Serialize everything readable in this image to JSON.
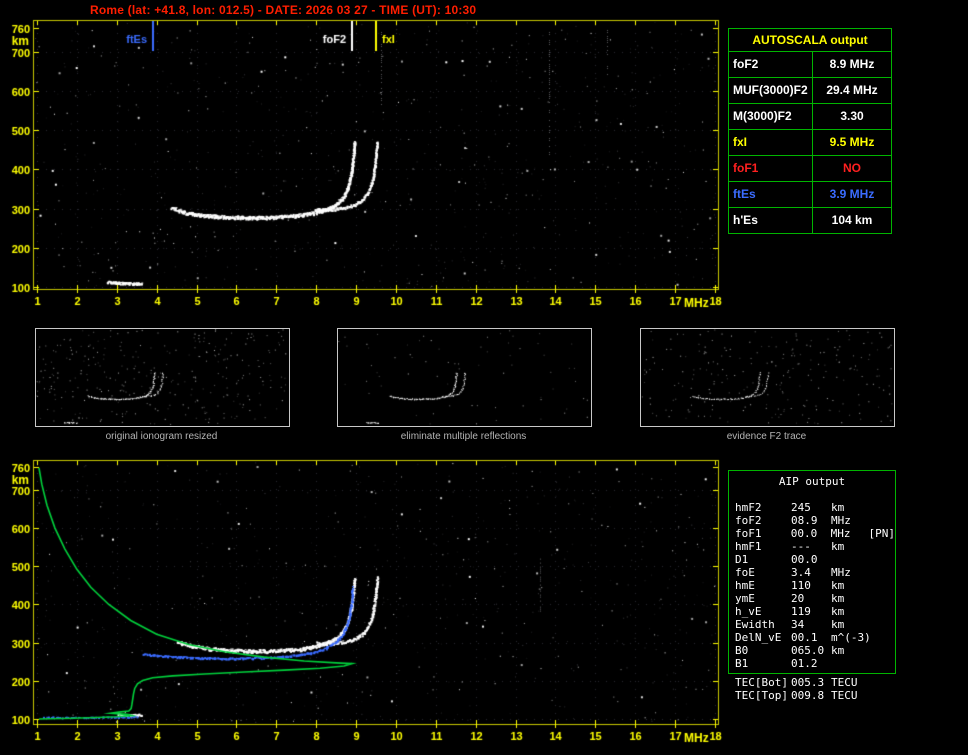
{
  "title": "Rome (lat: +41.8, lon: 012.5) - DATE: 2026 03 27 - TIME (UT): 10:30",
  "autoscala": {
    "header": "AUTOSCALA output",
    "border_color": "#00b400",
    "rows": [
      {
        "label": "foF2",
        "value": "8.9 MHz",
        "color": "#ffffff"
      },
      {
        "label": "MUF(3000)F2",
        "value": "29.4 MHz",
        "color": "#ffffff"
      },
      {
        "label": "M(3000)F2",
        "value": "3.30",
        "color": "#ffffff"
      },
      {
        "label": "fxI",
        "value": "9.5 MHz",
        "color": "#ffff00"
      },
      {
        "label": "foF1",
        "value": "NO",
        "color": "#ff2020"
      },
      {
        "label": "ftEs",
        "value": "3.9 MHz",
        "color": "#3b6cff"
      },
      {
        "label": "h'Es",
        "value": "104  km",
        "color": "#ffffff"
      }
    ]
  },
  "thumbnails": {
    "captions": [
      "original ionogram resized",
      "eliminate multiple reflections",
      "evidence F2 trace"
    ],
    "configs": [
      {
        "noise": 310,
        "density_mul": 0.5
      },
      {
        "noise": 70,
        "density_mul": 0.5
      },
      {
        "noise": 240,
        "density_mul": 0.35,
        "min_height": 280
      }
    ]
  },
  "aip": {
    "header": "AIP output",
    "rows": [
      {
        "label": "hmF2",
        "value": "245",
        "unit": "km",
        "extra": ""
      },
      {
        "label": "foF2",
        "value": "08.9",
        "unit": "MHz",
        "extra": ""
      },
      {
        "label": "foF1",
        "value": "00.0",
        "unit": "MHz",
        "extra": "[PN]"
      },
      {
        "label": "hmF1",
        "value": "---",
        "unit": "km",
        "extra": ""
      },
      {
        "label": "D1",
        "value": "00.0",
        "unit": "",
        "extra": ""
      },
      {
        "label": "foE",
        "value": "3.4",
        "unit": "MHz",
        "extra": ""
      },
      {
        "label": "hmE",
        "value": "110",
        "unit": "km",
        "extra": ""
      },
      {
        "label": "ymE",
        "value": "20",
        "unit": "km",
        "extra": ""
      },
      {
        "label": "h_vE",
        "value": "119",
        "unit": "km",
        "extra": ""
      },
      {
        "label": "Ewidth",
        "value": "34",
        "unit": "km",
        "extra": ""
      },
      {
        "label": "DelN_vE",
        "value": "00.1",
        "unit": "m^(-3)",
        "extra": ""
      },
      {
        "label": "B0",
        "value": "065.0",
        "unit": "km",
        "extra": ""
      },
      {
        "label": "B1",
        "value": "01.2",
        "unit": "",
        "extra": ""
      }
    ],
    "tec_rows": [
      {
        "label": "TEC[Bot]",
        "value": "005.3",
        "unit": "TECU",
        "extra": ""
      },
      {
        "label": "TEC[Top]",
        "value": "009.8",
        "unit": "TECU",
        "extra": ""
      }
    ]
  },
  "chart_data": [
    {
      "id": "scaled-ionogram",
      "type": "scatter",
      "title": "",
      "xlabel": "MHz",
      "ylabel": "km",
      "xlim": [
        1,
        18
      ],
      "ylim": [
        100,
        760
      ],
      "x_ticks": [
        1,
        2,
        3,
        4,
        5,
        6,
        7,
        8,
        9,
        10,
        11,
        12,
        13,
        14,
        15,
        16,
        17,
        18
      ],
      "y_ticks": [
        760,
        700,
        600,
        500,
        400,
        300,
        200,
        100
      ],
      "frame_color": "#c8c800",
      "axis_color": "#ffff00",
      "grid": "dotted",
      "markers": [
        {
          "label": "ftEs",
          "x": 3.9,
          "color": "#3b6cff",
          "side": "left"
        },
        {
          "label": "foF2",
          "x": 8.9,
          "color": "#ffffff",
          "side": "left"
        },
        {
          "label": "fxI",
          "x": 9.5,
          "color": "#ffff00",
          "side": "right"
        }
      ],
      "noise": {
        "bright": 240,
        "dim": 430
      },
      "streaks": [
        {
          "f": 13.85,
          "top": 760,
          "bottom": 420
        },
        {
          "f": 9.62,
          "top": 760,
          "bottom": 560
        },
        {
          "f": 15.3,
          "top": 760,
          "bottom": 640
        }
      ],
      "series": [
        {
          "name": "Es trace",
          "color": "#ffffff",
          "style": "dots",
          "size": 2,
          "density": 2.2,
          "jitter": 1.0,
          "points": [
            [
              2.75,
              114
            ],
            [
              3.1,
              111
            ],
            [
              3.4,
              110
            ],
            [
              3.62,
              111
            ]
          ]
        },
        {
          "name": "F2 ordinary trace",
          "color": "#ffffff",
          "style": "dots",
          "size": 2,
          "density": 2.4,
          "jitter": 1.6,
          "points": [
            [
              4.35,
              303
            ],
            [
              4.7,
              291
            ],
            [
              5.1,
              284
            ],
            [
              5.6,
              280
            ],
            [
              6.1,
              278
            ],
            [
              6.6,
              278
            ],
            [
              7.1,
              280
            ],
            [
              7.5,
              283
            ],
            [
              7.9,
              289
            ],
            [
              8.2,
              297
            ],
            [
              8.45,
              309
            ],
            [
              8.65,
              327
            ],
            [
              8.78,
              352
            ],
            [
              8.87,
              390
            ],
            [
              8.92,
              435
            ],
            [
              8.95,
              470
            ]
          ]
        },
        {
          "name": "F2 extraordinary trace",
          "color": "#ffffff",
          "style": "dots",
          "size": 2,
          "density": 1.7,
          "jitter": 1.2,
          "points": [
            [
              7.95,
              299
            ],
            [
              8.3,
              298
            ],
            [
              8.65,
              302
            ],
            [
              8.95,
              310
            ],
            [
              9.15,
              322
            ],
            [
              9.3,
              343
            ],
            [
              9.4,
              372
            ],
            [
              9.46,
              408
            ],
            [
              9.5,
              448
            ],
            [
              9.52,
              472
            ]
          ]
        }
      ]
    },
    {
      "id": "restored-ionogram-with-profile",
      "type": "scatter",
      "title": "",
      "xlabel": "MHz",
      "ylabel": "km",
      "xlim": [
        1,
        18
      ],
      "ylim": [
        100,
        760
      ],
      "x_ticks": [
        1,
        2,
        3,
        4,
        5,
        6,
        7,
        8,
        9,
        10,
        11,
        12,
        13,
        14,
        15,
        16,
        17,
        18
      ],
      "y_ticks": [
        760,
        700,
        600,
        500,
        400,
        300,
        200,
        100
      ],
      "frame_color": "#c8c800",
      "axis_color": "#ffff00",
      "grid": "dotted",
      "markers": [],
      "noise": {
        "bright": 190,
        "dim": 360
      },
      "streaks": [
        {
          "f": 13.6,
          "top": 520,
          "bottom": 380
        }
      ],
      "series": [
        {
          "name": "F2 ordinary trace",
          "color": "#ffffff",
          "style": "dots",
          "size": 2,
          "density": 2.2,
          "jitter": 1.6,
          "points": [
            [
              4.5,
              303
            ],
            [
              4.9,
              292
            ],
            [
              5.3,
              285
            ],
            [
              5.8,
              281
            ],
            [
              6.3,
              279
            ],
            [
              6.8,
              279
            ],
            [
              7.2,
              281
            ],
            [
              7.6,
              284
            ],
            [
              7.9,
              290
            ],
            [
              8.2,
              298
            ],
            [
              8.45,
              310
            ],
            [
              8.65,
              328
            ],
            [
              8.78,
              353
            ],
            [
              8.87,
              392
            ],
            [
              8.92,
              437
            ],
            [
              8.95,
              470
            ]
          ]
        },
        {
          "name": "F2 extraordinary trace",
          "color": "#ffffff",
          "style": "dots",
          "size": 2,
          "density": 1.6,
          "jitter": 1.2,
          "points": [
            [
              8.0,
              300
            ],
            [
              8.35,
              299
            ],
            [
              8.7,
              303
            ],
            [
              8.95,
              311
            ],
            [
              9.15,
              323
            ],
            [
              9.3,
              344
            ],
            [
              9.4,
              373
            ],
            [
              9.46,
              410
            ],
            [
              9.5,
              450
            ],
            [
              9.52,
              473
            ]
          ]
        },
        {
          "name": "Es trace",
          "color": "#ffffff",
          "style": "dots",
          "size": 2,
          "density": 1.8,
          "jitter": 0.8,
          "points": [
            [
              3.0,
              114
            ],
            [
              3.3,
              111
            ],
            [
              3.6,
              112
            ]
          ]
        },
        {
          "name": "autoscala restored trace",
          "color": "#3b6cff",
          "style": "dots",
          "size": 2,
          "density": 1.2,
          "jitter": 0.7,
          "points": [
            [
              3.65,
              271
            ],
            [
              4.1,
              266
            ],
            [
              4.6,
              263
            ],
            [
              5.1,
              261
            ],
            [
              5.6,
              260
            ],
            [
              6.1,
              260
            ],
            [
              6.6,
              261
            ],
            [
              7.1,
              264
            ],
            [
              7.5,
              268
            ],
            [
              7.9,
              275
            ],
            [
              8.2,
              285
            ],
            [
              8.45,
              300
            ],
            [
              8.65,
              322
            ],
            [
              8.78,
              352
            ],
            [
              8.87,
              400
            ],
            [
              8.9,
              448
            ]
          ]
        },
        {
          "name": "E region restored trace",
          "color": "#3b6cff",
          "style": "dots",
          "size": 2,
          "density": 0.5,
          "jitter": 0.4,
          "points": [
            [
              1.15,
              106
            ],
            [
              1.7,
              105
            ],
            [
              2.3,
              105
            ],
            [
              2.9,
              106
            ],
            [
              3.5,
              107
            ]
          ]
        },
        {
          "name": "electron density profile",
          "color": "#00d23c",
          "style": "line",
          "width": 1.6,
          "points": [
            [
              1.05,
              758
            ],
            [
              1.12,
              715
            ],
            [
              1.25,
              660
            ],
            [
              1.45,
              600
            ],
            [
              1.7,
              545
            ],
            [
              2.0,
              492
            ],
            [
              2.35,
              445
            ],
            [
              2.8,
              400
            ],
            [
              3.35,
              358
            ],
            [
              4.0,
              322
            ],
            [
              4.8,
              295
            ],
            [
              5.7,
              276
            ],
            [
              6.7,
              262
            ],
            [
              7.7,
              252
            ],
            [
              8.5,
              247
            ],
            [
              8.9,
              245
            ],
            [
              8.7,
              239
            ],
            [
              8.1,
              233
            ],
            [
              7.2,
              228
            ],
            [
              6.2,
              223
            ],
            [
              5.2,
              218
            ],
            [
              4.4,
              213
            ],
            [
              3.9,
              208
            ],
            [
              3.65,
              201
            ],
            [
              3.52,
              192
            ],
            [
              3.45,
              180
            ],
            [
              3.42,
              166
            ],
            [
              3.4,
              152
            ],
            [
              3.38,
              138
            ],
            [
              3.36,
              127
            ],
            [
              3.3,
              121
            ],
            [
              3.05,
              118
            ],
            [
              2.85,
              115
            ],
            [
              3.25,
              112
            ],
            [
              3.38,
              109
            ],
            [
              3.0,
              106
            ],
            [
              2.5,
              104
            ],
            [
              1.9,
              102
            ],
            [
              1.3,
              100.5
            ],
            [
              1.05,
              100
            ]
          ]
        }
      ]
    }
  ]
}
